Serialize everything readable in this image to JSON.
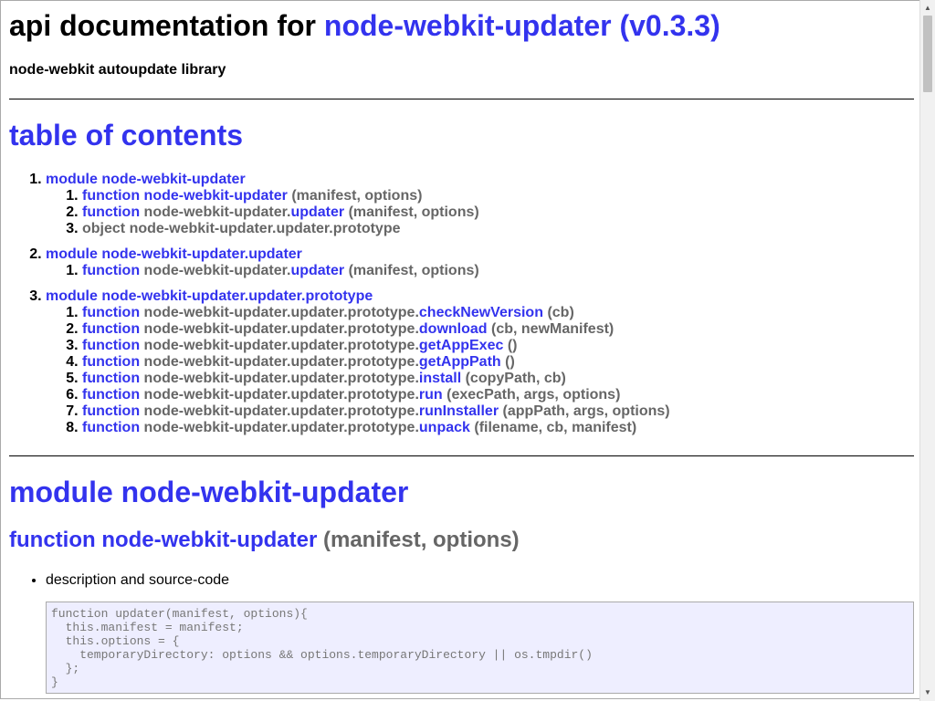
{
  "header": {
    "title_prefix": "api documentation for",
    "title_link": "node-webkit-updater (v0.3.3)",
    "subtitle": "node-webkit autoupdate library"
  },
  "toc": {
    "title": "table of contents",
    "modules": [
      {
        "label": "module node-webkit-updater",
        "items": [
          {
            "kw": "function",
            "path": "",
            "name": "node-webkit-updater",
            "args": "(manifest, options)"
          },
          {
            "kw": "function",
            "path": "node-webkit-updater.",
            "name": "updater",
            "args": "(manifest, options)"
          },
          {
            "kw": "object",
            "path": "node-webkit-updater.updater.prototype",
            "name": "",
            "args": "",
            "plain": true
          }
        ]
      },
      {
        "label": "module node-webkit-updater.updater",
        "items": [
          {
            "kw": "function",
            "path": "node-webkit-updater.",
            "name": "updater",
            "args": "(manifest, options)"
          }
        ]
      },
      {
        "label": "module node-webkit-updater.updater.prototype",
        "items": [
          {
            "kw": "function",
            "path": "node-webkit-updater.updater.prototype.",
            "name": "checkNewVersion",
            "args": "(cb)"
          },
          {
            "kw": "function",
            "path": "node-webkit-updater.updater.prototype.",
            "name": "download",
            "args": "(cb, newManifest)"
          },
          {
            "kw": "function",
            "path": "node-webkit-updater.updater.prototype.",
            "name": "getAppExec",
            "args": "()"
          },
          {
            "kw": "function",
            "path": "node-webkit-updater.updater.prototype.",
            "name": "getAppPath",
            "args": "()"
          },
          {
            "kw": "function",
            "path": "node-webkit-updater.updater.prototype.",
            "name": "install",
            "args": "(copyPath, cb)"
          },
          {
            "kw": "function",
            "path": "node-webkit-updater.updater.prototype.",
            "name": "run",
            "args": "(execPath, args, options)"
          },
          {
            "kw": "function",
            "path": "node-webkit-updater.updater.prototype.",
            "name": "runInstaller",
            "args": "(appPath, args, options)"
          },
          {
            "kw": "function",
            "path": "node-webkit-updater.updater.prototype.",
            "name": "unpack",
            "args": "(filename, cb, manifest)"
          }
        ]
      }
    ]
  },
  "module_section": {
    "title": "module node-webkit-updater",
    "function_kw": "function",
    "function_name": "node-webkit-updater",
    "function_args": "(manifest, options)",
    "bullet": "description and source-code",
    "code": "function updater(manifest, options){\n  this.manifest = manifest;\n  this.options = {\n    temporaryDirectory: options && options.temporaryDirectory || os.tmpdir()\n  };\n}"
  },
  "scrollbar": {
    "up_icon": "arrow-up-icon",
    "down_icon": "arrow-down-icon"
  }
}
